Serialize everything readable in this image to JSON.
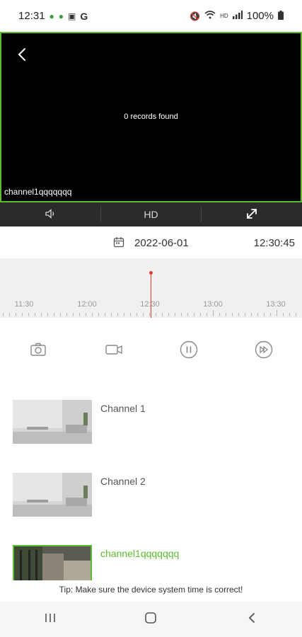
{
  "status": {
    "time": "12:31",
    "battery": "100%",
    "icons_left": [
      "person-icon",
      "dot-icon",
      "clipboard-icon",
      "google-icon"
    ],
    "icons_right": [
      "mute-icon",
      "wifi-icon",
      "hd-icon",
      "signal-icon",
      "battery-icon"
    ]
  },
  "player": {
    "message": "0 records found",
    "channel_overlay": "channel1qqqqqqq",
    "border_color": "#5dbb2f"
  },
  "controls": {
    "audio_icon": "speaker-icon",
    "quality_label": "HD",
    "fullscreen_icon": "expand-icon"
  },
  "date_bar": {
    "date": "2022-06-01",
    "time": "12:30:45"
  },
  "timeline": {
    "labels": [
      "11:30",
      "12:00",
      "12:30",
      "13:00",
      "13:30"
    ],
    "needle_color": "#e53935"
  },
  "actions": [
    "camera-icon",
    "record-icon",
    "pause-icon",
    "fast-forward-icon"
  ],
  "channels": [
    {
      "name": "Channel 1",
      "selected": false
    },
    {
      "name": "Channel 2",
      "selected": false
    },
    {
      "name": "channel1qqqqqqq",
      "selected": true
    }
  ],
  "tip": "Tip: Make sure the device system time is correct!",
  "accent_color": "#5dbb2f"
}
